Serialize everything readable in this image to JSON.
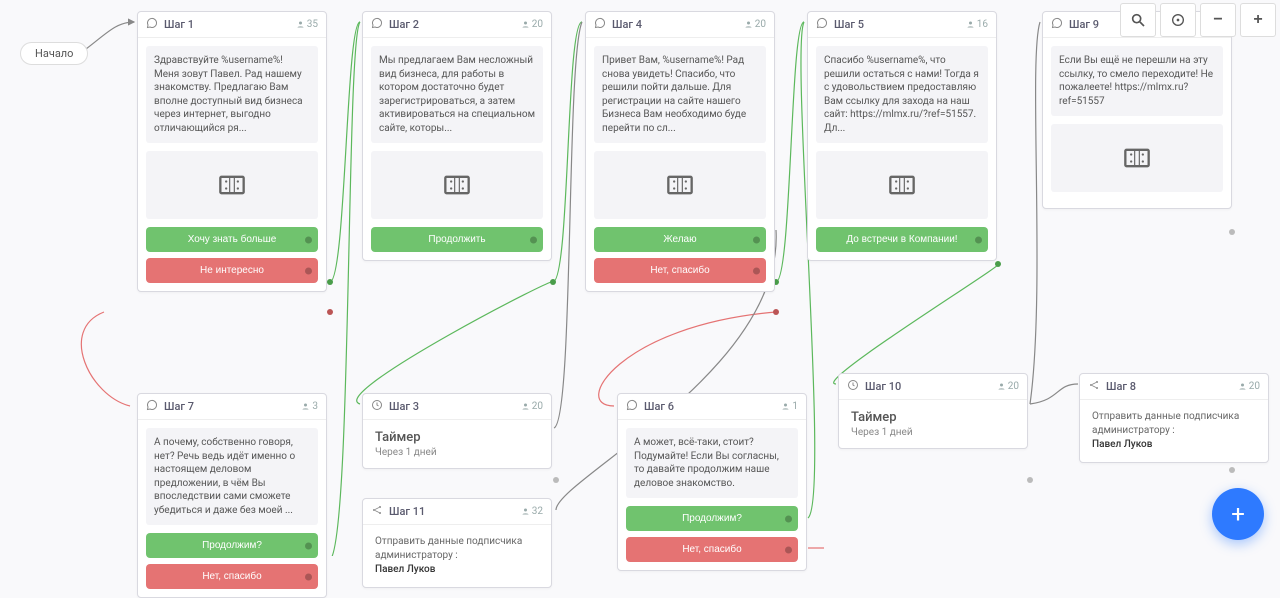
{
  "start_label": "Начало",
  "toolbar": {
    "zoom_in": "+",
    "zoom_out": "−"
  },
  "fab": "+",
  "steps": {
    "s1": {
      "title": "Шаг 1",
      "count": "35",
      "msg": "Здравствуйте %username%! Меня зовут Павел. Рад нашему знакомству. Предлагаю Вам вполне доступный вид бизнеса через интернет, выгодно отличающийся ря...",
      "btn1": "Хочу знать больше",
      "btn2": "Не интересно"
    },
    "s2": {
      "title": "Шаг 2",
      "count": "20",
      "msg": "Мы предлагаем Вам несложный вид бизнеса, для работы в котором достаточно будет зарегистрироваться, а затем активироваться на специальном сайте, которы...",
      "btn1": "Продолжить"
    },
    "s4": {
      "title": "Шаг 4",
      "count": "20",
      "msg": "Привет Вам, %username%! Рад снова увидеть! Спасибо, что решили пойти дальше. Для регистрации на сайте нашего Бизнеса Вам необходимо буде перейти по сл...",
      "btn1": "Желаю",
      "btn2": "Нет, спасибо"
    },
    "s5": {
      "title": "Шаг 5",
      "count": "16",
      "msg": "Спасибо %username%, что решили остаться с нами! Тогда я с удовольствием предоставляю Вам ссылку для захода на наш сайт: https://mlmx.ru/?ref=51557. Дл...",
      "btn1": "До встречи в Компании!"
    },
    "s9": {
      "title": "Шаг 9",
      "count": "20",
      "msg": "Если Вы ещё не перешли на эту ссылку, то смело переходите! Не пожалеете! https://mlmx.ru?ref=51557"
    },
    "s7": {
      "title": "Шаг 7",
      "count": "3",
      "msg": "А почему, собственно говоря, нет? Речь ведь идёт именно о настоящем деловом предложении, в чём Вы впоследствии сами сможете убедиться и даже без моей ...",
      "btn1": "Продолжим?",
      "btn2": "Нет, спасибо"
    },
    "s3": {
      "title": "Шаг 3",
      "count": "20",
      "timer_title": "Таймер",
      "timer_sub": "Через 1 дней"
    },
    "s11": {
      "title": "Шаг 11",
      "count": "32",
      "admin_text": "Отправить данные подписчика администратору :",
      "admin_name": "Павел Луков"
    },
    "s6": {
      "title": "Шаг 6",
      "count": "1",
      "msg": "А может, всё-таки, стоит? Подумайте! Если Вы согласны, то давайте продолжим наше деловое знакомство.",
      "btn1": "Продолжим?",
      "btn2": "Нет, спасибо"
    },
    "s10": {
      "title": "Шаг 10",
      "count": "20",
      "timer_title": "Таймер",
      "timer_sub": "Через 1 дней"
    },
    "s8": {
      "title": "Шаг 8",
      "count": "20",
      "admin_text": "Отправить данные подписчика администратору :",
      "admin_name": "Павел Луков"
    }
  }
}
